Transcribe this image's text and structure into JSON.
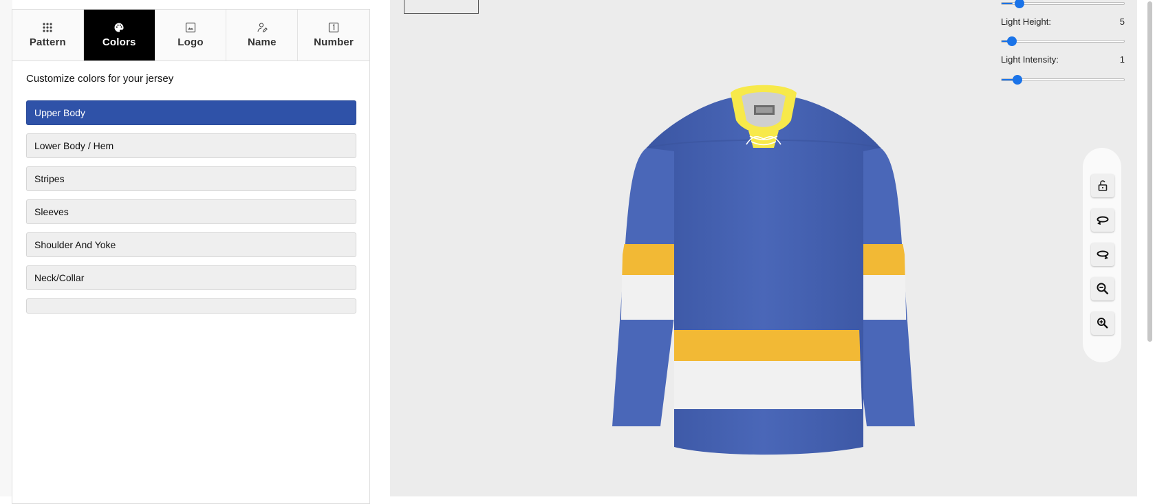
{
  "tabs": [
    {
      "label": "Pattern",
      "icon": "pattern-grid-icon",
      "active": false
    },
    {
      "label": "Colors",
      "icon": "palette-icon",
      "active": true
    },
    {
      "label": "Logo",
      "icon": "image-icon",
      "active": false
    },
    {
      "label": "Name",
      "icon": "person-edit-icon",
      "active": false
    },
    {
      "label": "Number",
      "icon": "number-box-icon",
      "active": false
    }
  ],
  "colors_panel": {
    "subtitle": "Customize colors for your jersey",
    "items": [
      {
        "label": "Upper Body",
        "selected": true
      },
      {
        "label": "Lower Body / Hem",
        "selected": false
      },
      {
        "label": "Stripes",
        "selected": false
      },
      {
        "label": "Sleeves",
        "selected": false
      },
      {
        "label": "Shoulder And Yoke",
        "selected": false
      },
      {
        "label": "Neck/Collar",
        "selected": false
      },
      {
        "label": "",
        "selected": false
      }
    ]
  },
  "lighting": {
    "height_label": "Light Height:",
    "height_value": "5",
    "intensity_label": "Light Intensity:",
    "intensity_value": "1"
  },
  "view_tools": [
    "unlock-icon",
    "rotate-left-icon",
    "rotate-right-icon",
    "zoom-out-icon",
    "zoom-in-icon"
  ],
  "jersey_colors": {
    "body": "#4a67b8",
    "stripe_yellow": "#f2b935",
    "stripe_white": "#f1f1f1",
    "collar": "#f7e94a"
  },
  "accent": "#2f52a8"
}
